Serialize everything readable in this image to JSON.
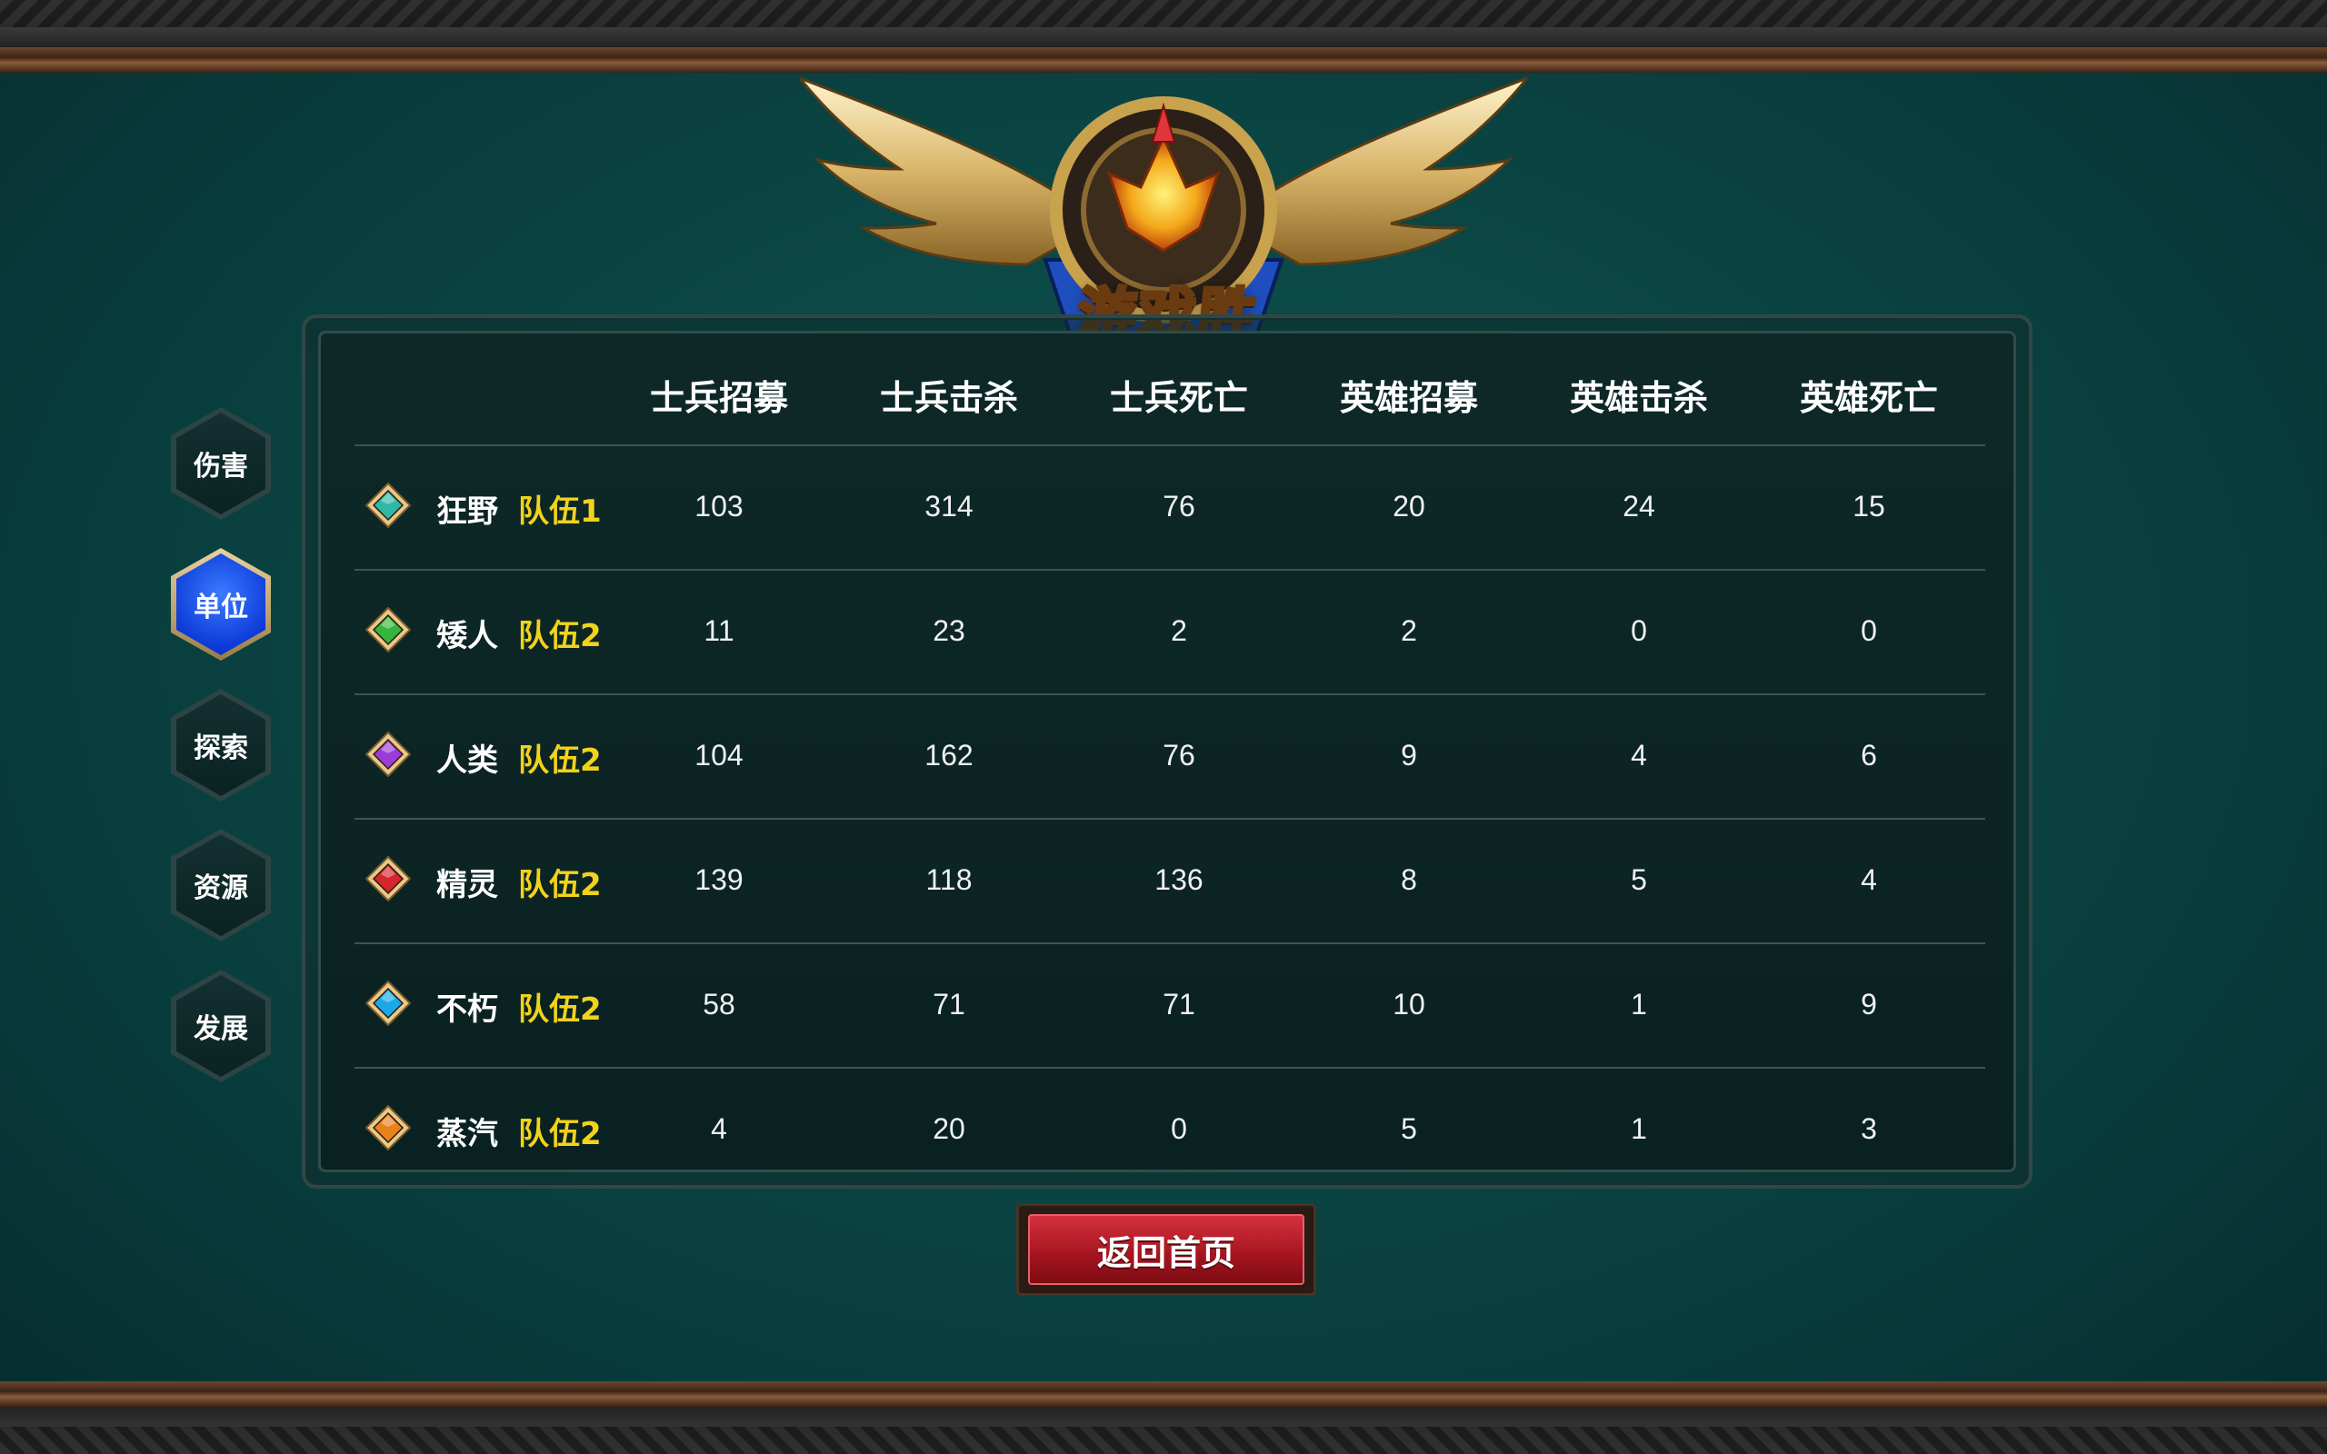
{
  "emblem": {
    "title": "游戏胜利"
  },
  "side_nav": {
    "items": [
      {
        "label": "伤害",
        "active": false
      },
      {
        "label": "单位",
        "active": true
      },
      {
        "label": "探索",
        "active": false
      },
      {
        "label": "资源",
        "active": false
      },
      {
        "label": "发展",
        "active": false
      }
    ]
  },
  "table": {
    "columns": [
      "士兵招募",
      "士兵击杀",
      "士兵死亡",
      "英雄招募",
      "英雄击杀",
      "英雄死亡"
    ],
    "rows": [
      {
        "race": "狂野",
        "team": "队伍1",
        "gem_color": "#2fb8a8",
        "values": [
          "103",
          "314",
          "76",
          "20",
          "24",
          "15"
        ]
      },
      {
        "race": "矮人",
        "team": "队伍2",
        "gem_color": "#35b53c",
        "values": [
          "11",
          "23",
          "2",
          "2",
          "0",
          "0"
        ]
      },
      {
        "race": "人类",
        "team": "队伍2",
        "gem_color": "#9b3cd6",
        "values": [
          "104",
          "162",
          "76",
          "9",
          "4",
          "6"
        ]
      },
      {
        "race": "精灵",
        "team": "队伍2",
        "gem_color": "#d4262c",
        "values": [
          "139",
          "118",
          "136",
          "8",
          "5",
          "4"
        ]
      },
      {
        "race": "不朽",
        "team": "队伍2",
        "gem_color": "#1aa8e8",
        "values": [
          "58",
          "71",
          "71",
          "10",
          "1",
          "9"
        ]
      },
      {
        "race": "蒸汽",
        "team": "队伍2",
        "gem_color": "#e8821a",
        "values": [
          "4",
          "20",
          "0",
          "5",
          "1",
          "3"
        ]
      }
    ]
  },
  "return_button": {
    "label": "返回首页"
  },
  "colors": {
    "team_label": "#f2d31a",
    "active_tab": "#1a55f0",
    "return_button": "#b8202c"
  }
}
